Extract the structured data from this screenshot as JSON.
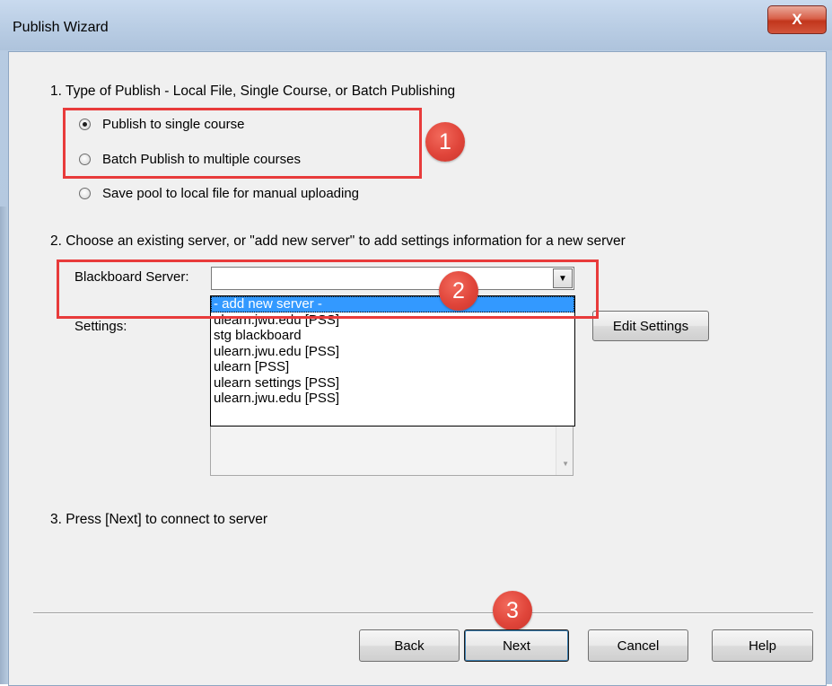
{
  "window": {
    "title": "Publish Wizard",
    "close_label": "X"
  },
  "step1": {
    "label": "1.  Type of Publish - Local File, Single Course, or Batch Publishing",
    "options": [
      {
        "label": "Publish to single course",
        "checked": true
      },
      {
        "label": "Batch Publish to multiple courses",
        "checked": false
      },
      {
        "label": "Save pool to local file for manual uploading",
        "checked": false
      }
    ]
  },
  "step2": {
    "label": "2.  Choose an existing server, or \"add new server\" to add settings information for a new server",
    "server_label": "Blackboard Server:",
    "server_value": "",
    "settings_label": "Settings:",
    "dropdown_items": [
      "- add new server -",
      "ulearn.jwu.edu [PSS]",
      "stg blackboard",
      "ulearn.jwu.edu [PSS]",
      "ulearn [PSS]",
      "ulearn settings [PSS]",
      "ulearn.jwu.edu [PSS]"
    ],
    "selected_index": 0,
    "edit_settings_label": "Edit Settings"
  },
  "step3": {
    "label": "3.  Press [Next] to connect to server"
  },
  "buttons": {
    "back": "Back",
    "next": "Next",
    "cancel": "Cancel",
    "help": "Help"
  },
  "annotations": {
    "badge1": "1",
    "badge2": "2",
    "badge3": "3",
    "highlight_color": "#e83b3b"
  }
}
